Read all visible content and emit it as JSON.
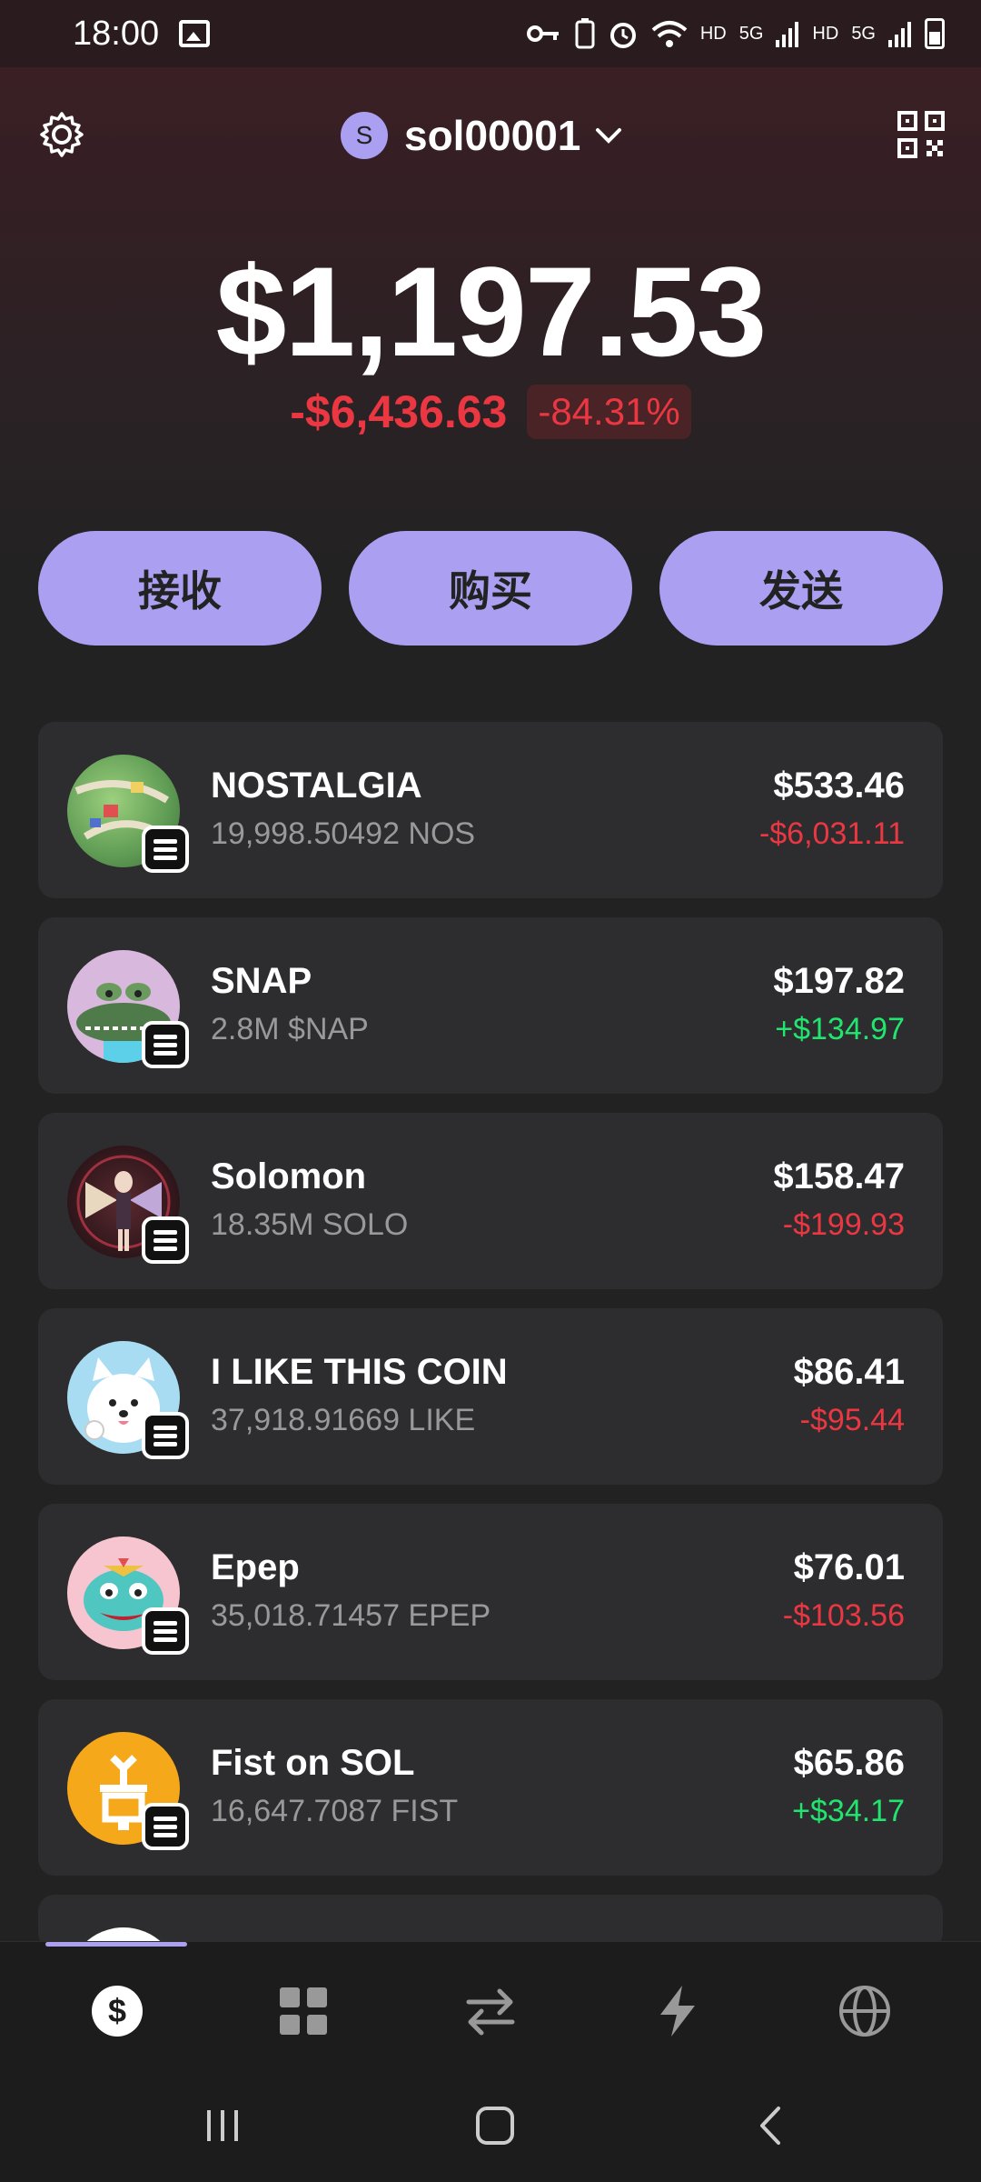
{
  "status_bar": {
    "time": "18:00",
    "hd1": "HD",
    "net1": "5G",
    "hd2": "HD",
    "net2": "5G"
  },
  "header": {
    "account_initial": "S",
    "account_name": "sol00001"
  },
  "portfolio": {
    "balance": "$1,197.53",
    "change_abs": "-$6,436.63",
    "change_pct": "-84.31%"
  },
  "actions": {
    "receive": "接收",
    "buy": "购买",
    "send": "发送"
  },
  "tokens": [
    {
      "name": "NOSTALGIA",
      "amount": "19,998.50492 NOS",
      "value": "$533.46",
      "change": "-$6,031.11",
      "trend": "neg",
      "logo_color": "#7bbf6a"
    },
    {
      "name": "SNAP",
      "amount": "2.8M $NAP",
      "value": "$197.82",
      "change": "+$134.97",
      "trend": "pos",
      "logo_color": "#d9b8de"
    },
    {
      "name": "Solomon",
      "amount": "18.35M SOLO",
      "value": "$158.47",
      "change": "-$199.93",
      "trend": "neg",
      "logo_color": "#3a1f24"
    },
    {
      "name": "I LIKE THIS COIN",
      "amount": "37,918.91669 LIKE",
      "value": "$86.41",
      "change": "-$95.44",
      "trend": "neg",
      "logo_color": "#a8dcf2"
    },
    {
      "name": "Epep",
      "amount": "35,018.71457 EPEP",
      "value": "$76.01",
      "change": "-$103.56",
      "trend": "neg",
      "logo_color": "#f7c5d0"
    },
    {
      "name": "Fist on SOL",
      "amount": "16,647.7087 FIST",
      "value": "$65.86",
      "change": "+$34.17",
      "trend": "pos",
      "logo_color": "#f5a81a"
    }
  ],
  "colors": {
    "accent": "#ab9ff2",
    "negative": "#eb3742",
    "positive": "#21e56f"
  },
  "nav": {
    "items": [
      "dollar-icon",
      "grid-icon",
      "swap-icon",
      "bolt-icon",
      "globe-icon"
    ],
    "active": "dollar-icon"
  }
}
